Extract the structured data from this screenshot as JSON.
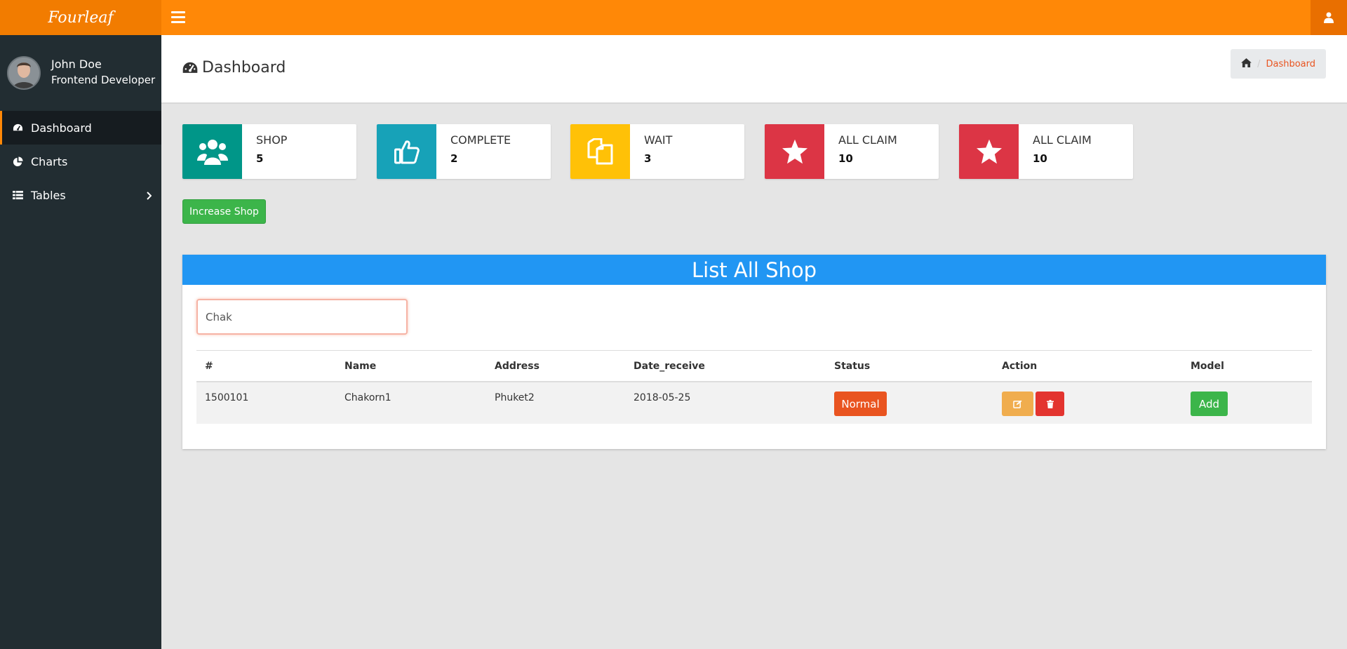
{
  "header": {
    "brand": "Fourleaf",
    "menu_icon": "hamburger-icon",
    "user_icon": "user-icon",
    "accent_color": "#ff8807"
  },
  "sidebar": {
    "user": {
      "name": "John Doe",
      "role": "Frontend Developer"
    },
    "items": [
      {
        "label": "Dashboard",
        "icon": "dashboard-icon",
        "active": true
      },
      {
        "label": "Charts",
        "icon": "pie-chart-icon",
        "active": false
      },
      {
        "label": "Tables",
        "icon": "table-icon",
        "active": false,
        "has_submenu": true
      }
    ]
  },
  "content_header": {
    "title": "Dashboard",
    "breadcrumb": {
      "home_icon": "home-icon",
      "current": "Dashboard"
    }
  },
  "stats": [
    {
      "label": "SHOP",
      "value": "5",
      "icon": "users-icon",
      "color": "#009688"
    },
    {
      "label": "COMPLETE",
      "value": "2",
      "icon": "thumbs-up-icon",
      "color": "#17a2b8"
    },
    {
      "label": "WAIT",
      "value": "3",
      "icon": "copy-icon",
      "color": "#ffc107"
    },
    {
      "label": "ALL CLAIM",
      "value": "10",
      "icon": "star-icon",
      "color": "#dc3545"
    },
    {
      "label": "ALL CLAIM",
      "value": "10",
      "icon": "star-icon",
      "color": "#dc3545"
    }
  ],
  "increase_button": "Increase Shop",
  "panel": {
    "title": "List All Shop",
    "search_value": "Chak",
    "columns": [
      "#",
      "Name",
      "Address",
      "Date_receive",
      "Status",
      "Action",
      "Model"
    ],
    "rows": [
      {
        "id": "1500101",
        "name": "Chakorn1",
        "address": "Phuket2",
        "date_receive": "2018-05-25",
        "status": "Normal",
        "model": "Add"
      }
    ]
  }
}
